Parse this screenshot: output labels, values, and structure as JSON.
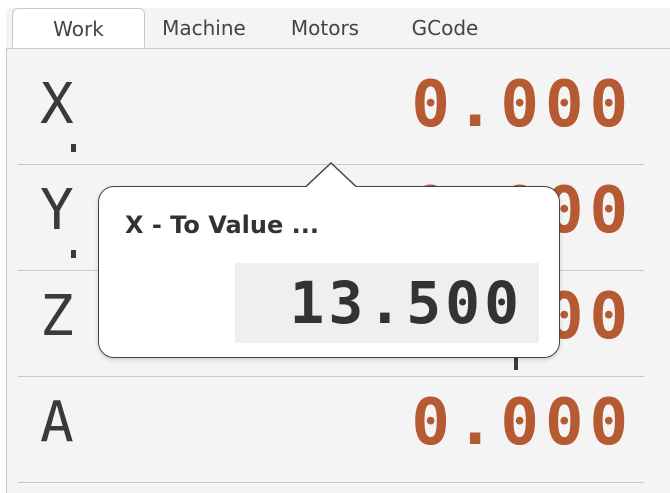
{
  "tabs": [
    {
      "label": "Work",
      "active": true
    },
    {
      "label": "Machine",
      "active": false
    },
    {
      "label": "Motors",
      "active": false
    },
    {
      "label": "GCode",
      "active": false
    }
  ],
  "axes": [
    {
      "label": "X",
      "value": "0.000"
    },
    {
      "label": "Y",
      "value": "0.000"
    },
    {
      "label": "Z",
      "value": "0.000"
    },
    {
      "label": "A",
      "value": "0.000"
    }
  ],
  "popup": {
    "title": "X - To Value ...",
    "value": "13.500"
  },
  "colors": {
    "value_color": "#b55a32",
    "label_color": "#3a3a3a",
    "background": "#f4f4f4"
  }
}
